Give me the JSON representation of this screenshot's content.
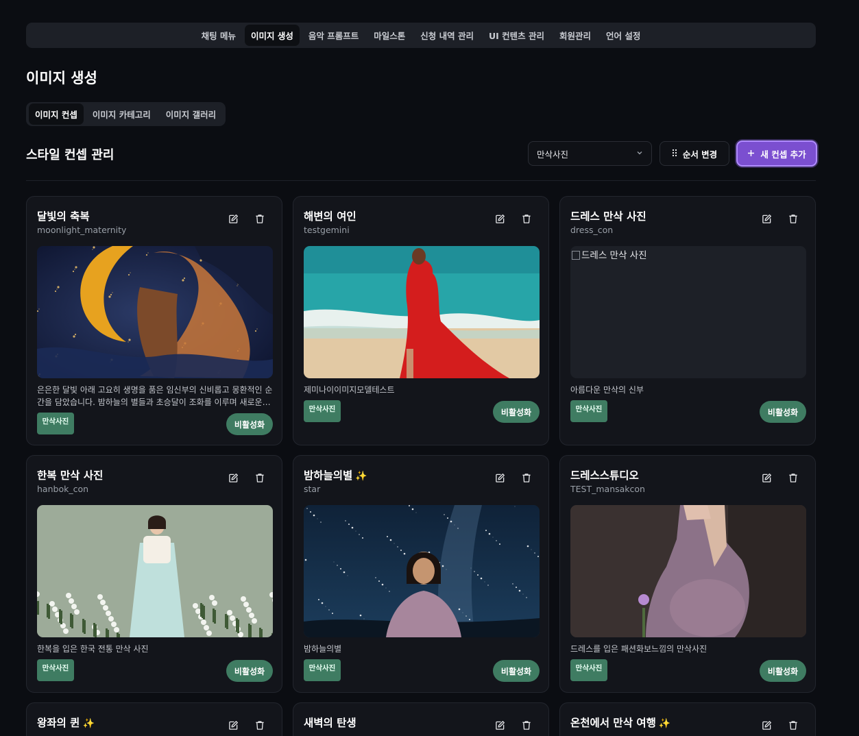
{
  "nav": {
    "items": [
      {
        "label": "채팅 메뉴",
        "active": false
      },
      {
        "label": "이미지 생성",
        "active": true
      },
      {
        "label": "음악 프롬프트",
        "active": false
      },
      {
        "label": "마일스톤",
        "active": false
      },
      {
        "label": "신청 내역 관리",
        "active": false
      },
      {
        "label": "UI 컨텐츠 관리",
        "active": false
      },
      {
        "label": "회원관리",
        "active": false
      },
      {
        "label": "언어 설정",
        "active": false
      }
    ]
  },
  "page": {
    "title": "이미지 생성"
  },
  "subtabs": [
    {
      "label": "이미지 컨셉",
      "active": true
    },
    {
      "label": "이미지 카테고리",
      "active": false
    },
    {
      "label": "이미지 갤러리",
      "active": false
    }
  ],
  "section": {
    "title": "스타일 컨셉 관리"
  },
  "filter": {
    "selected": "만삭사진"
  },
  "buttons": {
    "reorder": "순서 변경",
    "add": "새 컨셉 추가"
  },
  "colors": {
    "accent": "#7b4fd0",
    "badge": "#3f7c62",
    "bg": "#0b0d12",
    "card": "#13151b"
  },
  "cards": [
    {
      "title": "달빛의 축복",
      "key": "moonlight_maternity",
      "sparkle": false,
      "image": "moon",
      "description": "은은한 달빛 아래 고요히 생명을 품은 임신부의 신비롭고 몽환적인 순간을 담았습니다. 밤하늘의 별들과 초승달이 조화를 이루며 새로운 생명의 탄생을 축복합니다.",
      "badge": "만삭사진",
      "toggle": "비활성화"
    },
    {
      "title": "해변의 여인",
      "key": "testgemini",
      "sparkle": false,
      "image": "beach",
      "description": "제미나이이미지모델테스트",
      "badge": "만삭사진",
      "toggle": "비활성화"
    },
    {
      "title": "드레스 만삭 사진",
      "key": "dress_con",
      "sparkle": false,
      "image": "broken",
      "image_alt": "드레스 만삭 사진",
      "description": "아름다운 만삭의 신부",
      "badge": "만삭사진",
      "toggle": "비활성화"
    },
    {
      "title": "한복 만삭 사진",
      "key": "hanbok_con",
      "sparkle": false,
      "image": "hanbok",
      "description": "한복을 입은 한국 전통 만삭 사진",
      "badge": "만삭사진",
      "toggle": "비활성화"
    },
    {
      "title": "밤하늘의별",
      "key": "star",
      "sparkle": true,
      "image": "stars",
      "description": "밤하늘의별",
      "badge": "만삭사진",
      "toggle": "비활성화"
    },
    {
      "title": "드레스스튜디오",
      "key": "TEST_mansakcon",
      "sparkle": false,
      "image": "studio",
      "description": "드레스를 입은 패션화보느낌의 만삭사진",
      "badge": "만삭사진",
      "toggle": "비활성화"
    },
    {
      "title": "왕좌의 퀸",
      "key": "",
      "sparkle": true,
      "image": "none",
      "description": "",
      "badge": "",
      "toggle": ""
    },
    {
      "title": "새벽의 탄생",
      "key": "",
      "sparkle": false,
      "image": "none",
      "description": "",
      "badge": "",
      "toggle": ""
    },
    {
      "title": "온천에서 만삭 여행",
      "key": "",
      "sparkle": true,
      "image": "none",
      "description": "",
      "badge": "",
      "toggle": ""
    }
  ]
}
